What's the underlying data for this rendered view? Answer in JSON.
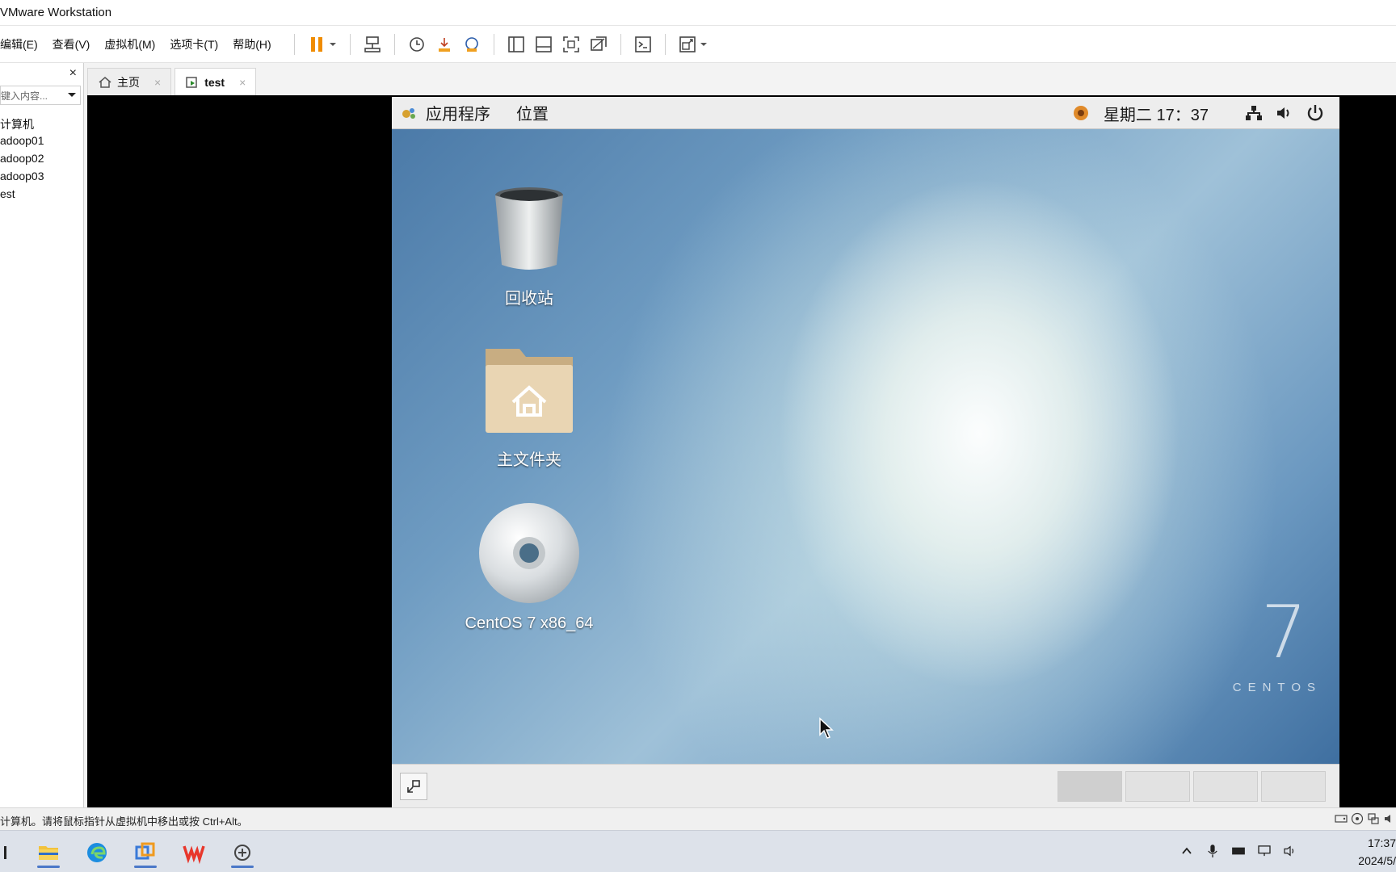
{
  "window": {
    "title": "VMware Workstation"
  },
  "menu": [
    "编辑(E)",
    "查看(V)",
    "虚拟机(M)",
    "选项卡(T)",
    "帮助(H)"
  ],
  "library": {
    "close_label": "×",
    "search_placeholder": "键入内容...",
    "items": [
      "计算机",
      "adoop01",
      "adoop02",
      "adoop03",
      "est"
    ]
  },
  "tabs": [
    {
      "label": "主页",
      "icon": "home-icon"
    },
    {
      "label": "test",
      "icon": "vm-icon"
    }
  ],
  "guest": {
    "topbar": {
      "applications": "应用程序",
      "places": "位置",
      "clock": "星期二 17：37"
    },
    "desktop_icons": [
      {
        "label": "回收站",
        "icon": "trash-icon"
      },
      {
        "label": "主文件夹",
        "icon": "home-folder-icon"
      },
      {
        "label": "CentOS 7 x86_64",
        "icon": "disc-icon"
      }
    ],
    "brand_number": "7",
    "brand_text": "CENTOS"
  },
  "status": {
    "message": "计算机。请将鼠标指针从虚拟机中移出或按 Ctrl+Alt。"
  },
  "taskbar": {
    "time": "17:37",
    "date": "2024/5/"
  },
  "colors": {
    "accent": "#4b78c8",
    "pause": "#f08c00"
  }
}
